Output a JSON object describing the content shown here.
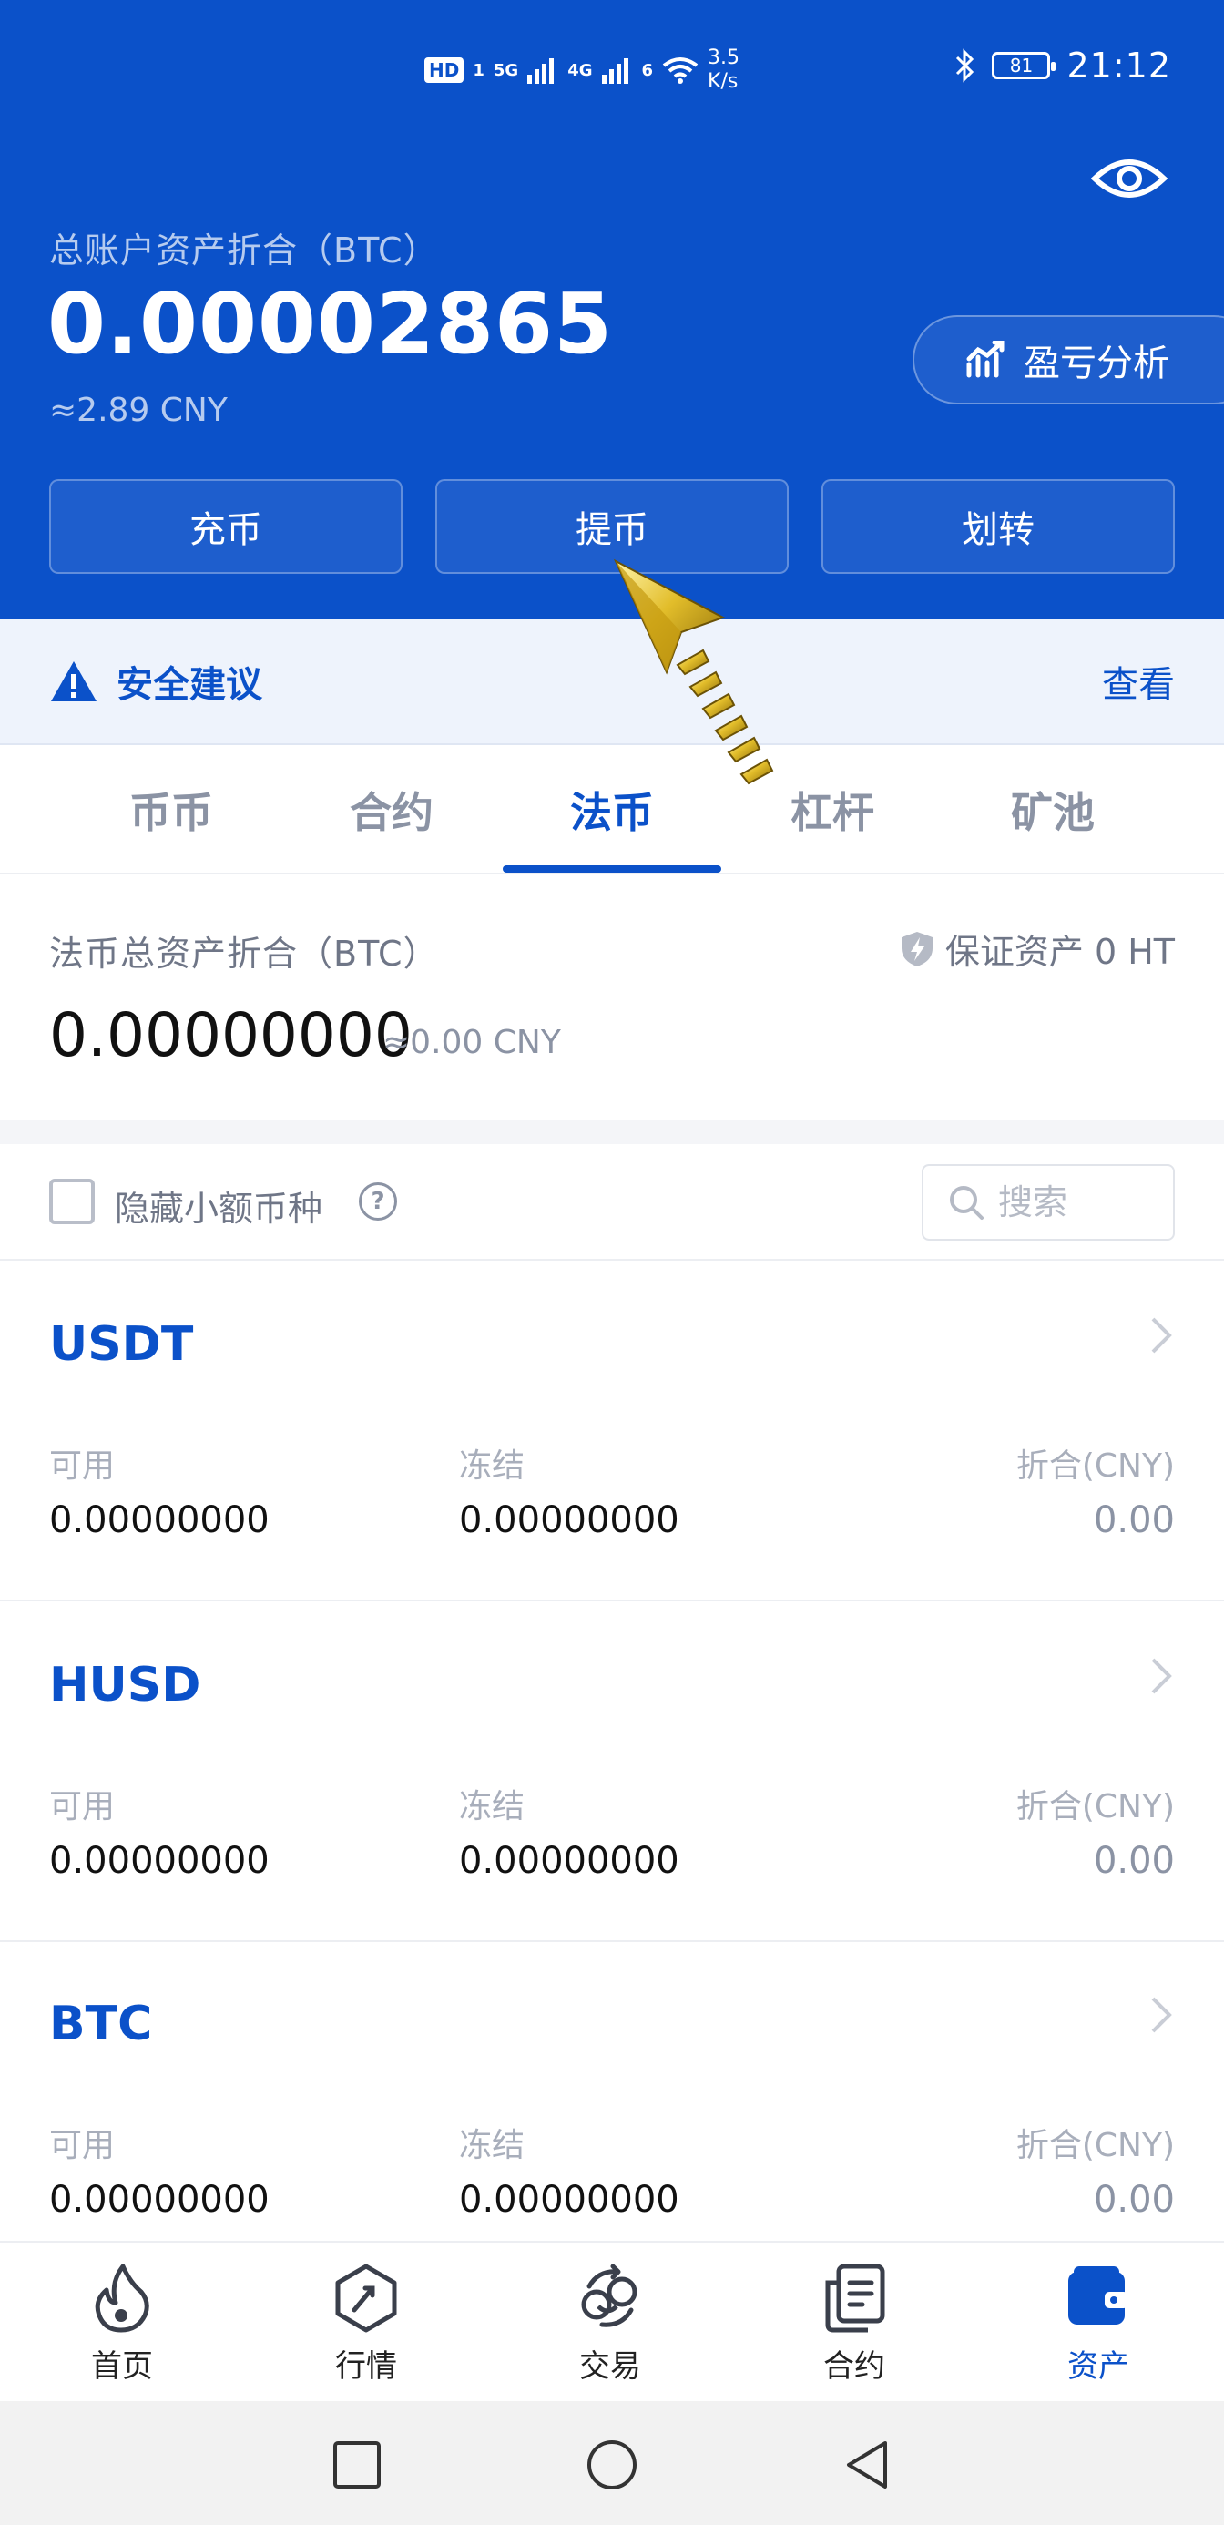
{
  "status_bar": {
    "hd_badge": "HD",
    "hd_slot": "1",
    "net1": "5G",
    "net2": "4G",
    "net3": "6",
    "speed_value": "3.5",
    "speed_unit": "K/s",
    "battery": "81",
    "time": "21:12"
  },
  "header": {
    "total_label": "总账户资产折合（BTC）",
    "total_value": "0.00002865",
    "total_cny": "≈2.89 CNY",
    "pnl_label": "盈亏分析",
    "actions": [
      "充币",
      "提币",
      "划转"
    ]
  },
  "security": {
    "title": "安全建议",
    "link": "查看"
  },
  "tabs": {
    "items": [
      "币币",
      "合约",
      "法币",
      "杠杆",
      "矿池"
    ],
    "active": "法币"
  },
  "summary": {
    "label": "法币总资产折合（BTC）",
    "guarantee": "保证资产 0 HT",
    "value": "0.00000000",
    "cny": "≈0.00 CNY"
  },
  "filter": {
    "hide_small_label": "隐藏小额币种",
    "help": "?",
    "search_placeholder": "搜索"
  },
  "coins": [
    {
      "name": "USDT",
      "available_label": "可用",
      "frozen_label": "冻结",
      "cny_label": "折合(CNY)",
      "available": "0.00000000",
      "frozen": "0.00000000",
      "cny": "0.00"
    },
    {
      "name": "HUSD",
      "available_label": "可用",
      "frozen_label": "冻结",
      "cny_label": "折合(CNY)",
      "available": "0.00000000",
      "frozen": "0.00000000",
      "cny": "0.00"
    },
    {
      "name": "BTC",
      "available_label": "可用",
      "frozen_label": "冻结",
      "cny_label": "折合(CNY)",
      "available": "0.00000000",
      "frozen": "0.00000000",
      "cny": "0.00"
    }
  ],
  "bottom_nav": {
    "items": [
      {
        "label": "首页",
        "icon": "flame-icon"
      },
      {
        "label": "行情",
        "icon": "market-icon"
      },
      {
        "label": "交易",
        "icon": "trade-icon"
      },
      {
        "label": "合约",
        "icon": "contract-icon"
      },
      {
        "label": "资产",
        "icon": "wallet-icon"
      }
    ],
    "active": "资产"
  },
  "colors": {
    "brand_blue": "#0b51c9",
    "pointer_gold": "#d8b020"
  }
}
